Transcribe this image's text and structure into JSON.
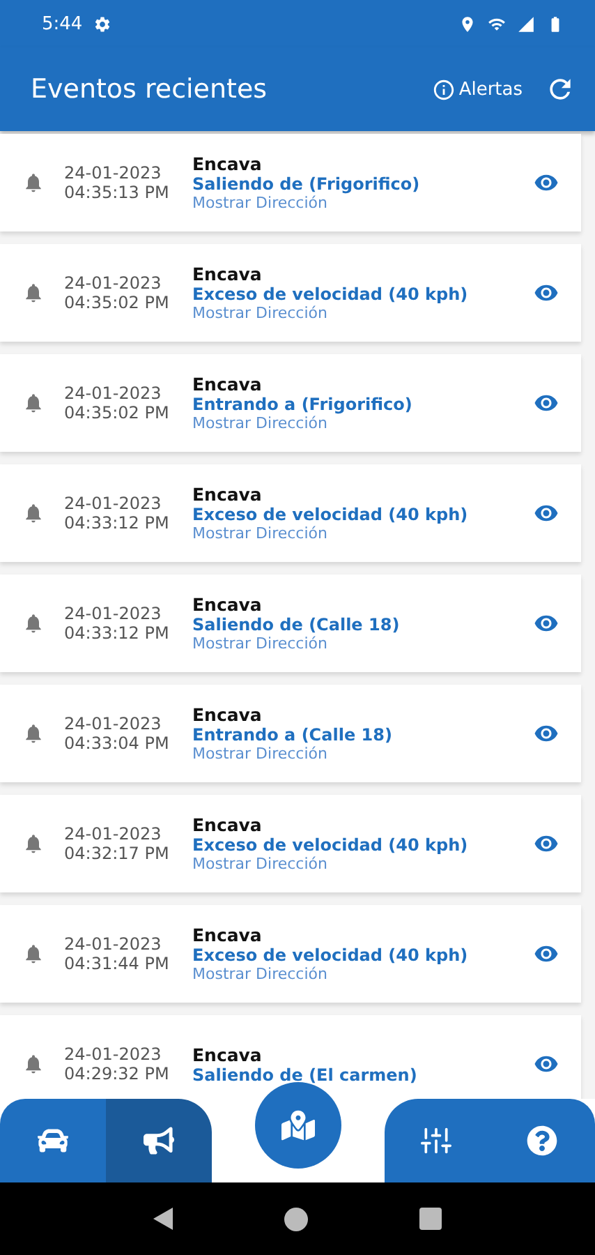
{
  "status_bar": {
    "time": "5:44"
  },
  "header": {
    "title": "Eventos recientes",
    "alerts_label": "Alertas"
  },
  "events": [
    {
      "date": "24-01-2023",
      "time": "04:35:13 PM",
      "unit": "Encava",
      "event": "Saliendo de (Frigorifico)",
      "link": "Mostrar Dirección"
    },
    {
      "date": "24-01-2023",
      "time": "04:35:02 PM",
      "unit": "Encava",
      "event": "Exceso de velocidad (40 kph)",
      "link": "Mostrar Dirección"
    },
    {
      "date": "24-01-2023",
      "time": "04:35:02 PM",
      "unit": "Encava",
      "event": "Entrando a (Frigorifico)",
      "link": "Mostrar Dirección"
    },
    {
      "date": "24-01-2023",
      "time": "04:33:12 PM",
      "unit": "Encava",
      "event": "Exceso de velocidad (40 kph)",
      "link": "Mostrar Dirección"
    },
    {
      "date": "24-01-2023",
      "time": "04:33:12 PM",
      "unit": "Encava",
      "event": "Saliendo de (Calle 18)",
      "link": "Mostrar Dirección"
    },
    {
      "date": "24-01-2023",
      "time": "04:33:04 PM",
      "unit": "Encava",
      "event": "Entrando a (Calle 18)",
      "link": "Mostrar Dirección"
    },
    {
      "date": "24-01-2023",
      "time": "04:32:17 PM",
      "unit": "Encava",
      "event": "Exceso de velocidad (40 kph)",
      "link": "Mostrar Dirección"
    },
    {
      "date": "24-01-2023",
      "time": "04:31:44 PM",
      "unit": "Encava",
      "event": "Exceso de velocidad (40 kph)",
      "link": "Mostrar Dirección"
    },
    {
      "date": "24-01-2023",
      "time": "04:29:32 PM",
      "unit": "Encava",
      "event": "Saliendo de (El carmen)"
    }
  ],
  "nav": [
    {
      "kind": "car",
      "selected": false
    },
    {
      "kind": "megaphone",
      "selected": true
    },
    {
      "kind": "map",
      "selected": false
    },
    {
      "kind": "sliders",
      "selected": false
    },
    {
      "kind": "help",
      "selected": false
    }
  ]
}
